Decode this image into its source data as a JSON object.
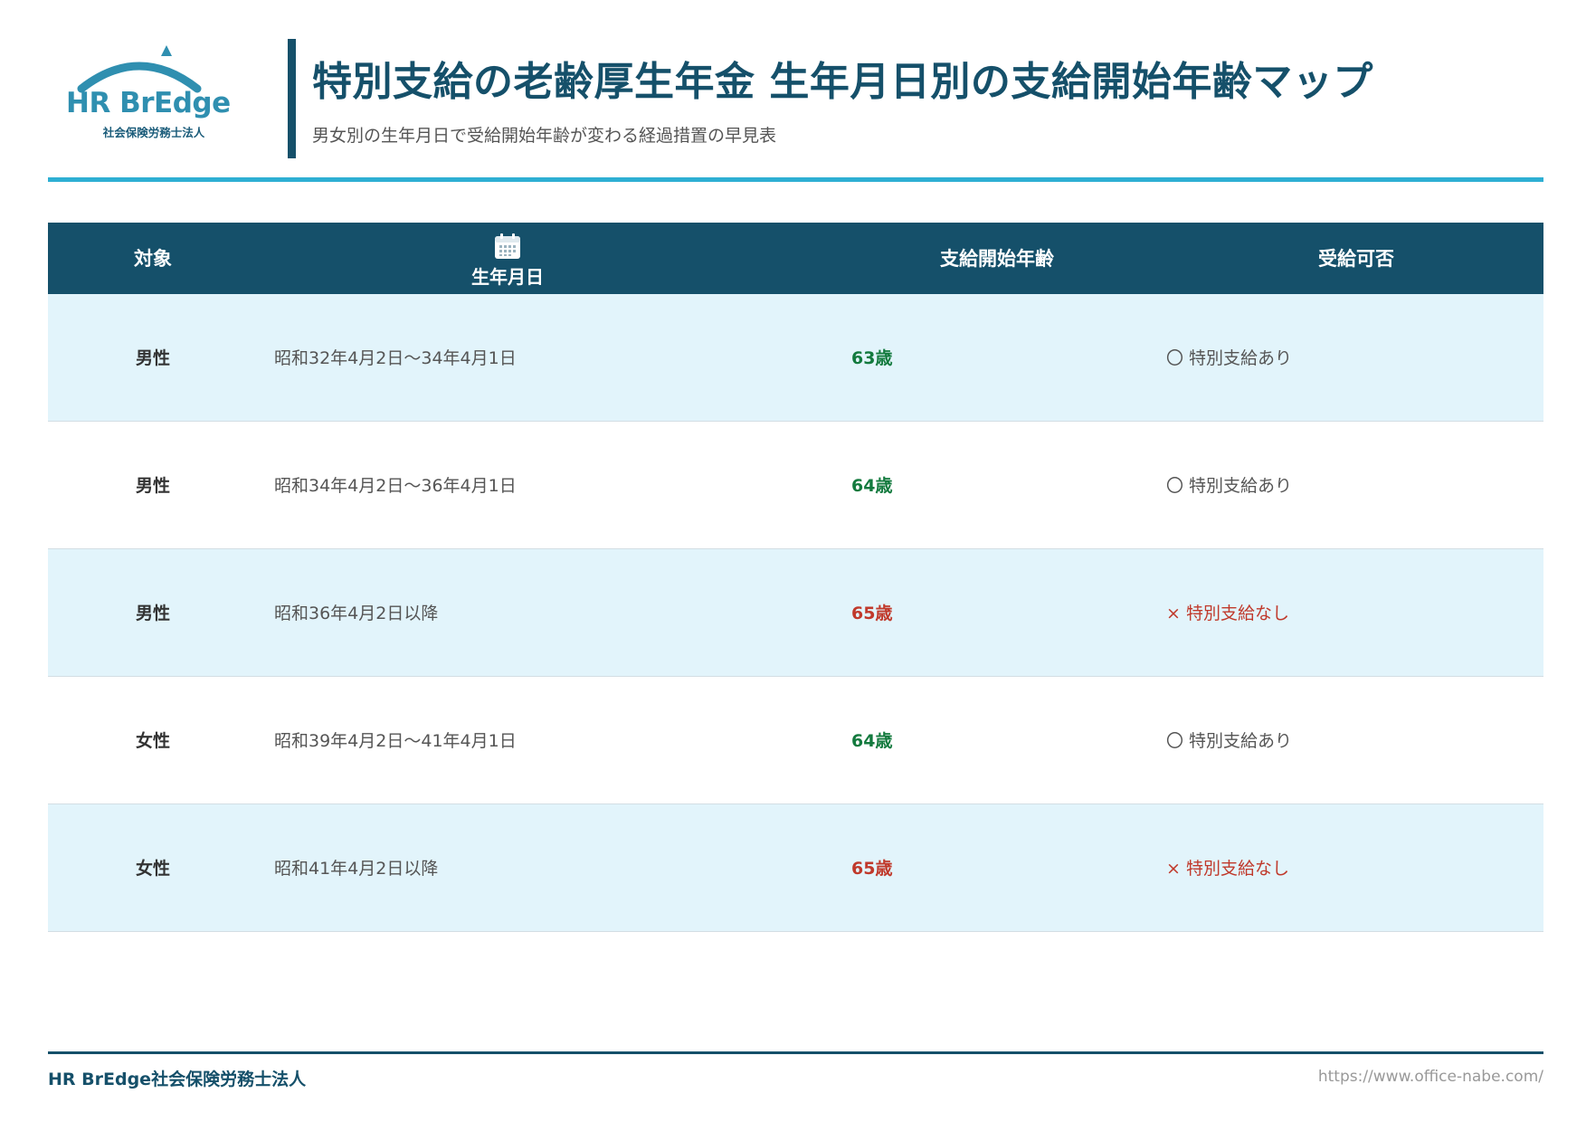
{
  "logo": {
    "name": "HR BrEdge",
    "subtitle": "社会保険労務士法人",
    "color": "#2f8fb0"
  },
  "header": {
    "title": "特別支給の老齢厚生年金 生年月日別の支給開始年齢マップ",
    "subtitle": "男女別の生年月日で受給開始年齢が変わる経過措置の早見表"
  },
  "table": {
    "columns": {
      "target": "対象",
      "dob": "生年月日",
      "age": "支給開始年齢",
      "eligibility": "受給可否"
    },
    "dob_icon": "calendar-icon",
    "rows": [
      {
        "target": "男性",
        "dob": "昭和32年4月2日〜34年4月1日",
        "age": "63歳",
        "eligibility": "〇 特別支給あり",
        "status": "ok"
      },
      {
        "target": "男性",
        "dob": "昭和34年4月2日〜36年4月1日",
        "age": "64歳",
        "eligibility": "〇 特別支給あり",
        "status": "ok"
      },
      {
        "target": "男性",
        "dob": "昭和36年4月2日以降",
        "age": "65歳",
        "eligibility": "× 特別支給なし",
        "status": "ng"
      },
      {
        "target": "女性",
        "dob": "昭和39年4月2日〜41年4月1日",
        "age": "64歳",
        "eligibility": "〇 特別支給あり",
        "status": "ok"
      },
      {
        "target": "女性",
        "dob": "昭和41年4月2日以降",
        "age": "65歳",
        "eligibility": "× 特別支給なし",
        "status": "ng"
      }
    ]
  },
  "colors": {
    "primary": "#15506a",
    "accent": "#2eafd3",
    "row_alt": "#e2f4fb",
    "ok": "#137a3e",
    "ng": "#c0392b"
  },
  "footer": {
    "company": "HR BrEdge社会保険労務士法人",
    "url": "https://www.office-nabe.com/"
  }
}
